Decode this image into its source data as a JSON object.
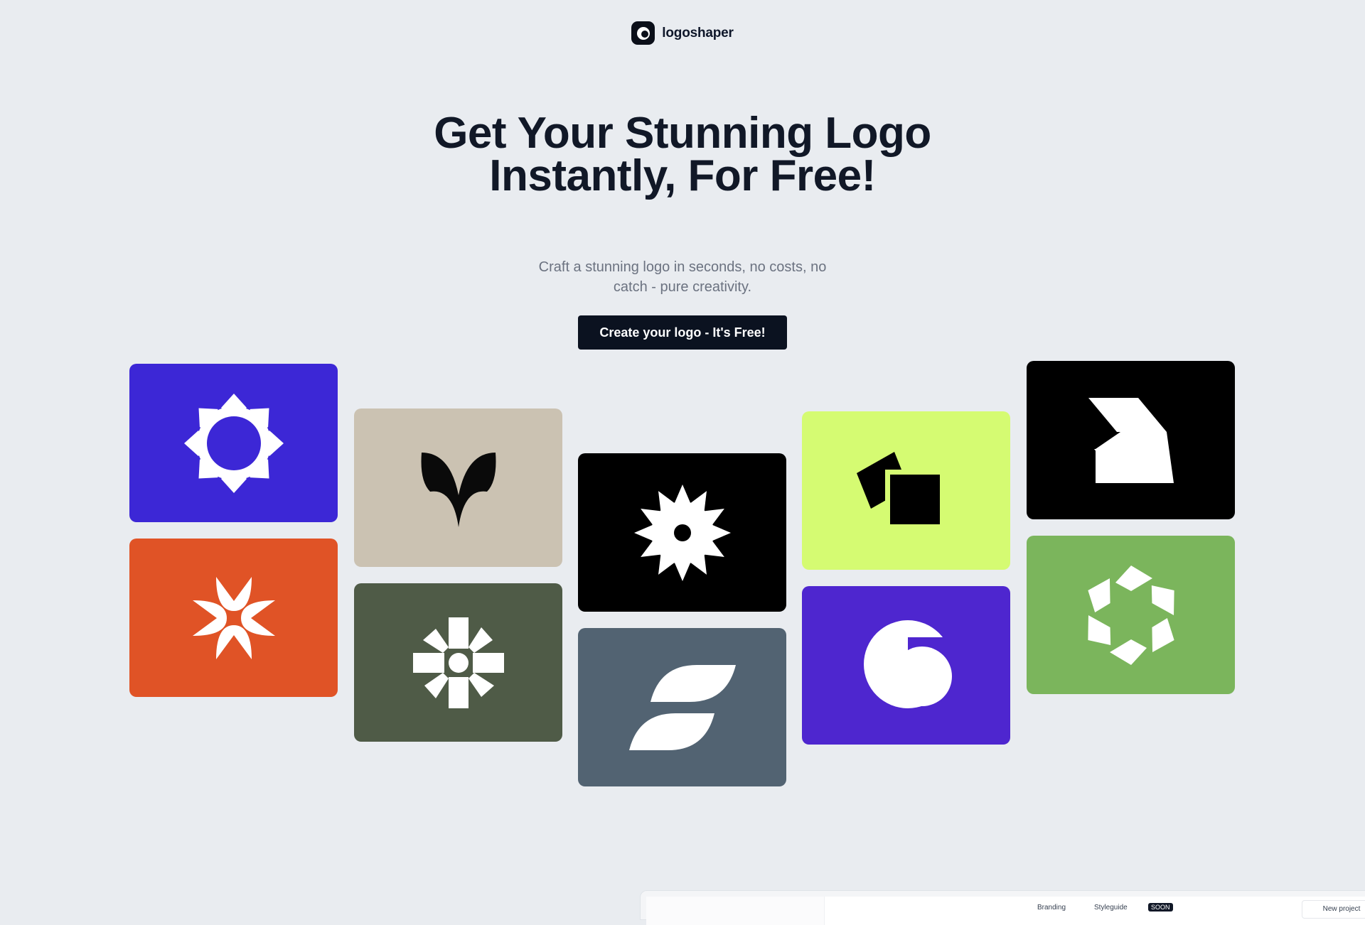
{
  "brand": {
    "name": "logoshaper",
    "icon": "logoshaper-mark-icon"
  },
  "hero": {
    "title": "Get Your Stunning Logo Instantly, For Free!",
    "subtitle": "Craft a stunning logo in seconds, no costs, no catch - pure creativity.",
    "cta_label": "Create your logo - It's Free!"
  },
  "logo_gallery": [
    {
      "icon": "flower-ring-icon",
      "background": "#3c27d6",
      "foreground": "#ffffff"
    },
    {
      "icon": "pinwheel-x-icon",
      "background": "#e05326",
      "foreground": "#ffffff"
    },
    {
      "icon": "leaf-tulip-icon",
      "background": "#cbc2b2",
      "foreground": "#0a0a0a"
    },
    {
      "icon": "cross-burst-icon",
      "background": "#4f5b47",
      "foreground": "#ffffff"
    },
    {
      "icon": "sun-gear-icon",
      "background": "#000000",
      "foreground": "#ffffff"
    },
    {
      "icon": "double-swoosh-icon",
      "background": "#526372",
      "foreground": "#ffffff"
    },
    {
      "icon": "stacked-squares-icon",
      "background": "#d5fb72",
      "foreground": "#000000"
    },
    {
      "icon": "circle-cutout-icon",
      "background": "#4e26cf",
      "foreground": "#ffffff"
    },
    {
      "icon": "zigzag-z-icon",
      "background": "#000000",
      "foreground": "#ffffff"
    },
    {
      "icon": "hex-spiral-icon",
      "background": "#7bb55c",
      "foreground": "#ffffff"
    }
  ],
  "app_preview": {
    "nav_items": [
      "Branding",
      "Styleguide"
    ],
    "badge": "SOON",
    "button": "New project"
  }
}
